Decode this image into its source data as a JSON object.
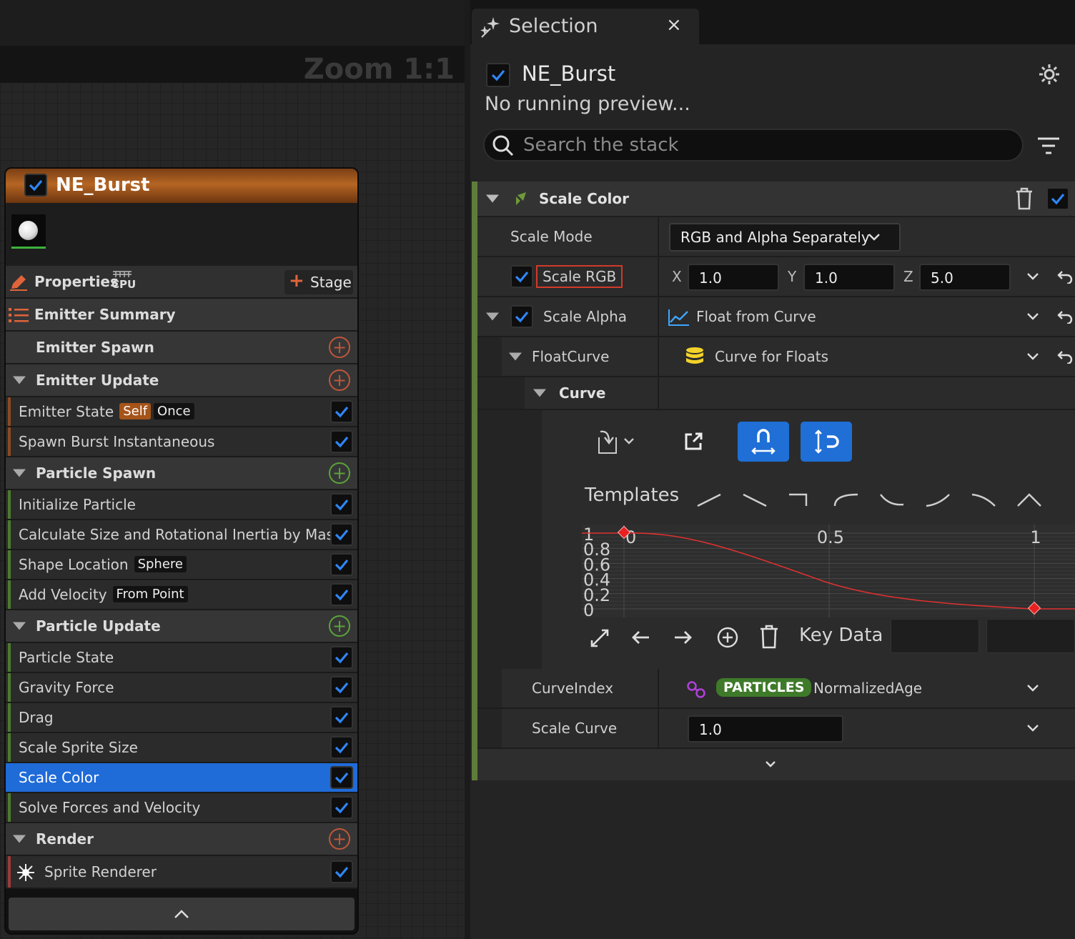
{
  "graph": {
    "zoom_label": "Zoom 1:1"
  },
  "node": {
    "title": "NE_Burst",
    "properties_label": "Properties",
    "cpu_label": "CPU",
    "stage_label": "Stage",
    "sections": [
      {
        "label": "Emitter Summary"
      },
      {
        "label": "Emitter Spawn"
      },
      {
        "label": "Emitter Update"
      },
      {
        "label": "Particle Spawn"
      },
      {
        "label": "Particle Update"
      },
      {
        "label": "Render"
      }
    ],
    "items": {
      "emitter_state": "Emitter State",
      "emitter_state_tag1": "Self",
      "emitter_state_tag2": "Once",
      "spawn_burst": "Spawn Burst Instantaneous",
      "init_particle": "Initialize Particle",
      "calc_size": "Calculate Size and Rotational Inertia by Mass",
      "shape_location": "Shape Location",
      "shape_location_tag": "Sphere",
      "add_velocity": "Add Velocity",
      "add_velocity_tag": "From Point",
      "particle_state": "Particle State",
      "gravity_force": "Gravity Force",
      "drag": "Drag",
      "scale_sprite_size": "Scale Sprite Size",
      "scale_color": "Scale Color",
      "solve_forces": "Solve Forces and Velocity",
      "sprite_renderer": "Sprite Renderer"
    }
  },
  "panel": {
    "tab_title": "Selection",
    "tab_close": "×",
    "selection_title": "NE_Burst",
    "status": "No running preview...",
    "search_placeholder": "Search the stack",
    "module": {
      "title": "Scale Color",
      "scale_mode_label": "Scale Mode",
      "scale_mode_value": "RGB and Alpha Separately",
      "scale_rgb_label": "Scale RGB",
      "x_label": "X",
      "x_value": "1.0",
      "y_label": "Y",
      "y_value": "1.0",
      "z_label": "Z",
      "z_value": "5.0",
      "scale_alpha_label": "Scale Alpha",
      "scale_alpha_value": "Float from Curve",
      "float_curve_label": "FloatCurve",
      "float_curve_value": "Curve for Floats",
      "curve_label": "Curve",
      "templates_label": "Templates",
      "key_data_label": "Key Data",
      "curve_index_label": "CurveIndex",
      "curve_index_badge": "PARTICLES",
      "curve_index_value": "NormalizedAge",
      "scale_curve_label": "Scale Curve",
      "scale_curve_value": "1.0"
    },
    "curve_graph": {
      "x_ticks": [
        "0",
        "0.5",
        "1"
      ],
      "y_ticks": [
        "1",
        "0.8",
        "0.6",
        "0.4",
        "0.2",
        "0"
      ]
    }
  },
  "colors": {
    "accent_blue": "#1f6fd6",
    "emitter_orange": "#b56523",
    "module_green": "#5f7d3a",
    "curve_red": "#e03030",
    "highlight_red": "#d23a2a"
  }
}
